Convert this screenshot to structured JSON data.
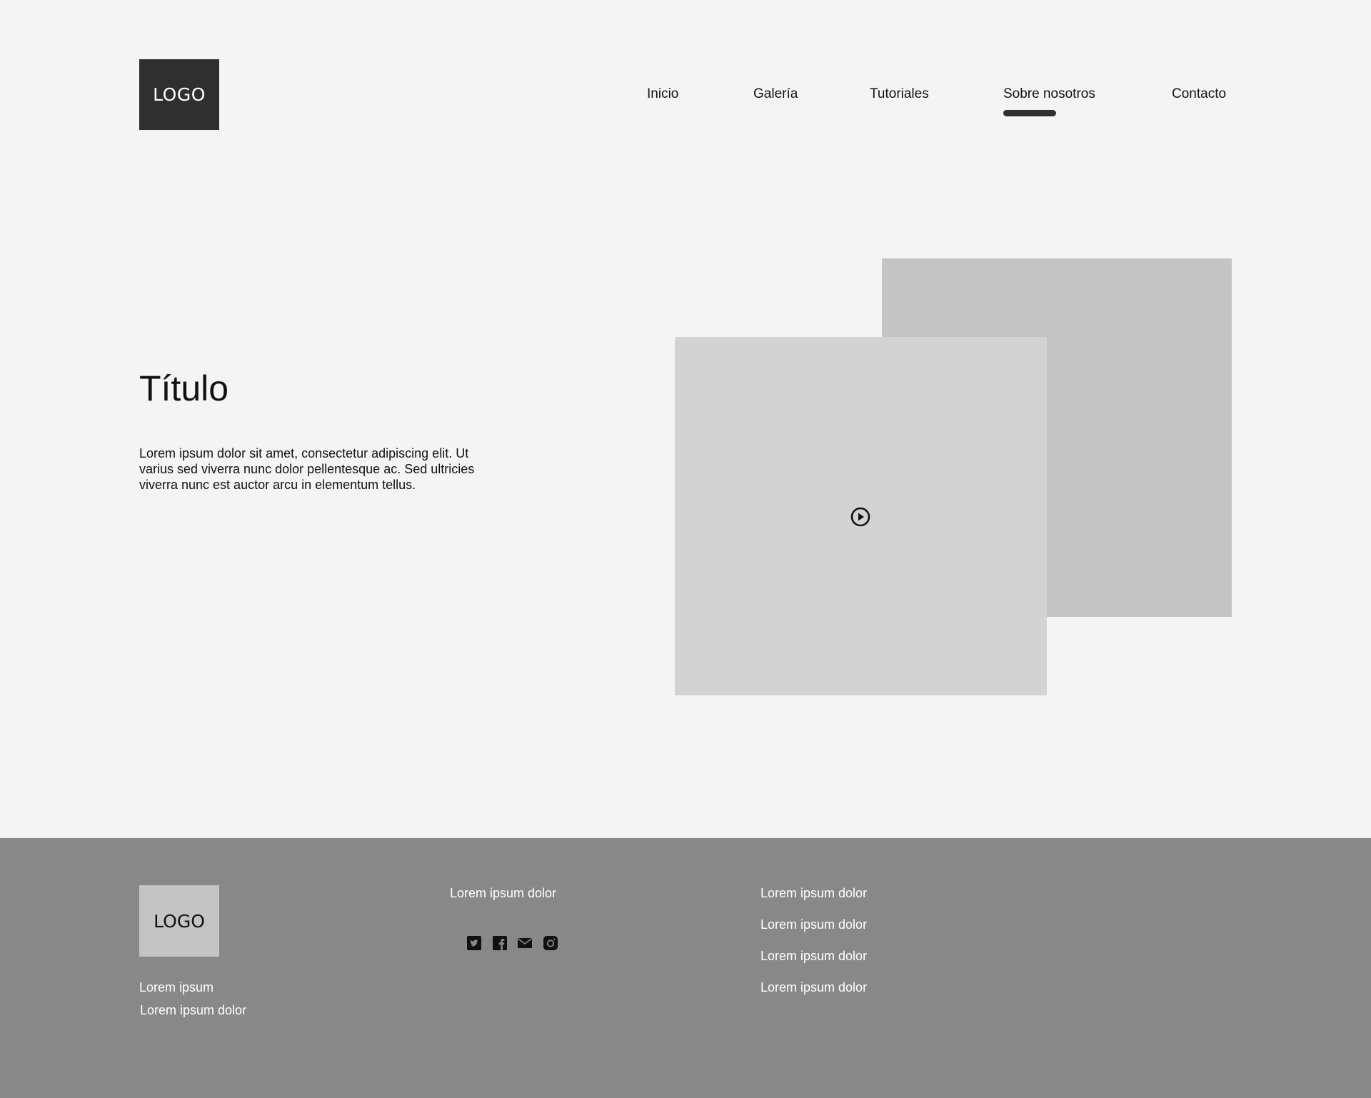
{
  "header": {
    "logo": "LOGO",
    "nav": [
      "Inicio",
      "Galería",
      "Tutoriales",
      "Sobre nosotros",
      "Contacto"
    ],
    "active_nav": "Sobre nosotros"
  },
  "hero": {
    "title": "Título",
    "text": "Lorem ipsum dolor sit amet, consectetur adipiscing elit. Ut varius sed viverra nunc dolor pellentesque ac. Sed ultricies viverra nunc est auctor arcu in elementum tellus.",
    "media_icon": "play-circle-icon"
  },
  "footer": {
    "logo": "LOGO",
    "tagline": "Lorem ipsum",
    "subtagline": "Lorem ipsum dolor",
    "col2_heading": "Lorem ipsum dolor",
    "social_icons": [
      "twitter-icon",
      "facebook-icon",
      "mail-icon",
      "instagram-icon"
    ],
    "links": [
      "Lorem ipsum dolor",
      "Lorem ipsum dolor",
      "Lorem ipsum dolor",
      "Lorem ipsum dolor"
    ]
  },
  "colors": {
    "background": "#f4f4f4",
    "logo_dark": "#2f2f2f",
    "image_back": "#c4c4c4",
    "image_front": "#d3d3d3",
    "footer": "#888888"
  }
}
